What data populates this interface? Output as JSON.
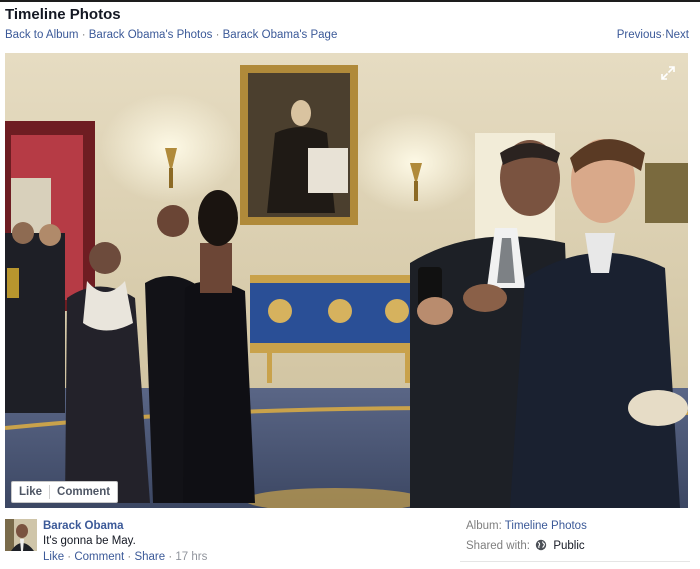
{
  "header": {
    "title": "Timeline Photos"
  },
  "breadcrumbs": [
    {
      "label": "Back to Album"
    },
    {
      "label": "Barack Obama's Photos"
    },
    {
      "label": "Barack Obama's Page"
    }
  ],
  "separator": " · ",
  "pager": {
    "previous": "Previous",
    "next": "Next"
  },
  "photo_controls": {
    "like": "Like",
    "comment": "Comment",
    "expand_icon": "expand-icon"
  },
  "post": {
    "author": "Barack Obama",
    "caption": "It's gonna be May.",
    "actions": {
      "like": "Like",
      "comment": "Comment",
      "share": "Share",
      "time": "17 hrs"
    }
  },
  "meta": {
    "album_label": "Album:",
    "album_value": "Timeline Photos",
    "shared_label": "Shared with:",
    "shared_value": "Public",
    "shared_icon": "globe-icon"
  },
  "colors": {
    "link": "#3b5998",
    "muted": "#7f7f7f",
    "text": "#141823"
  }
}
